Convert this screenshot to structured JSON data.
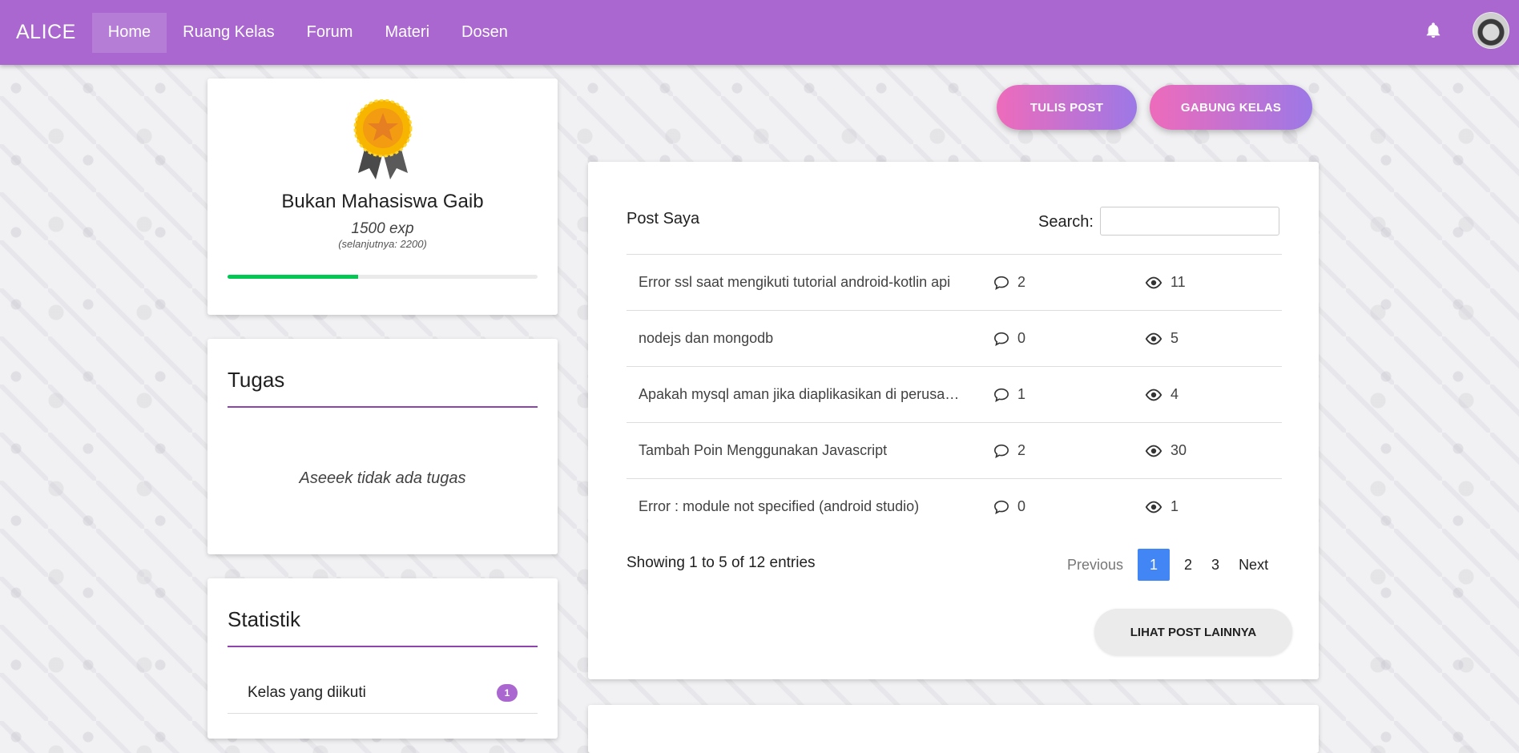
{
  "navbar": {
    "brand": "ALICE",
    "links": [
      {
        "label": "Home",
        "active": true
      },
      {
        "label": "Ruang Kelas"
      },
      {
        "label": "Forum"
      },
      {
        "label": "Materi"
      },
      {
        "label": "Dosen"
      }
    ],
    "bell_icon": "bell-icon",
    "avatar_icon": "user-avatar"
  },
  "profile": {
    "medal_icon": "medal-icon",
    "rank_title": "Bukan Mahasiswa Gaib",
    "exp": "1500 exp",
    "next": "(selanjutnya: 2200)",
    "progress_fraction": 0.42,
    "progress_color": "#00c853"
  },
  "tugas": {
    "title": "Tugas",
    "empty_message": "Aseeek tidak ada tugas"
  },
  "statistik": {
    "title": "Statistik",
    "rows": [
      {
        "label": "Kelas yang diikuti",
        "count": "1"
      }
    ]
  },
  "actions": {
    "tulis_post": "TULIS POST",
    "gabung_kelas": "GABUNG KELAS"
  },
  "posts": {
    "title": "Post Saya",
    "search_label": "Search:",
    "search_value": "",
    "items": [
      {
        "title": "Error ssl saat mengikuti tutorial android-kotlin api",
        "comments": "2",
        "views": "11"
      },
      {
        "title": "nodejs dan mongodb",
        "comments": "0",
        "views": "5"
      },
      {
        "title": "Apakah mysql aman jika diaplikasikan di perusahaan",
        "comments": "1",
        "views": "4"
      },
      {
        "title": "Tambah Poin Menggunakan Javascript",
        "comments": "2",
        "views": "30"
      },
      {
        "title": "Error : module not specified (android studio)",
        "comments": "0",
        "views": "1"
      }
    ],
    "showing": "Showing 1 to 5 of 12 entries",
    "pagination": {
      "previous": "Previous",
      "pages": [
        "1",
        "2",
        "3"
      ],
      "current": "1",
      "next": "Next"
    },
    "more_button": "LIHAT POST LAINNYA"
  },
  "colors": {
    "navbar": "#a967cf",
    "accent": "#8e44ad",
    "page_active": "#4285f4"
  }
}
